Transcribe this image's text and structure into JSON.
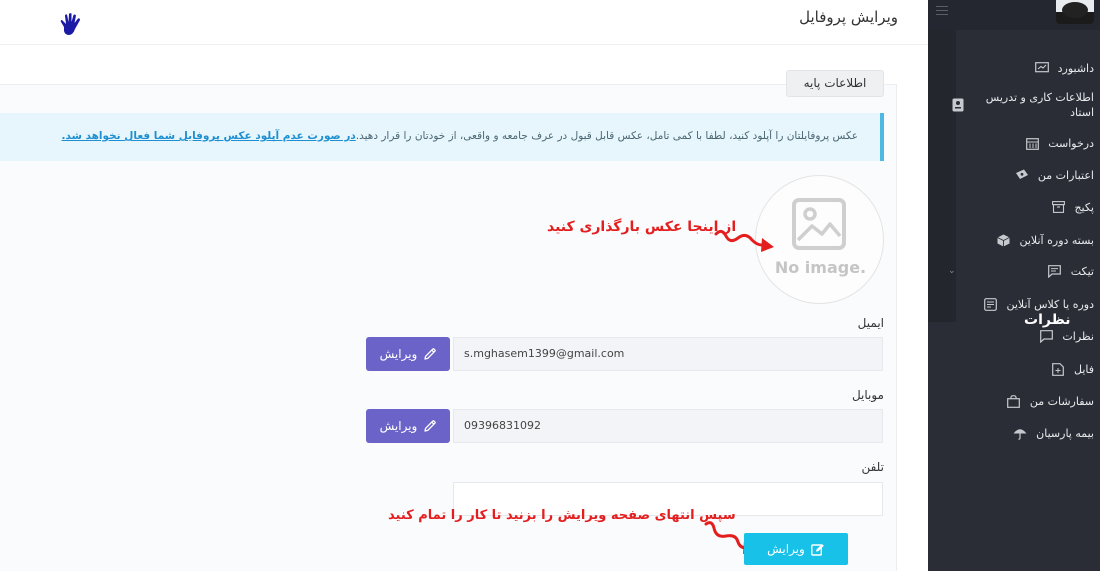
{
  "header": {
    "title": "ویرایش پروفایل"
  },
  "tab": {
    "label": "اطلاعات پایه"
  },
  "alert": {
    "text": "عکس پروفایلتان را آپلود کنید، لطفا با کمی تامل، عکس قابل قبول در عرف جامعه و واقعی، از خودتان را قرار دهید.",
    "warning": "در صورت عدم آپلود عکس پروفایل شما فعال نخواهد شد."
  },
  "avatar": {
    "placeholder": "No image."
  },
  "annotations": {
    "upload_hint": "از اینجا عکس بارگذاری کنید",
    "finish_hint": "سپس انتهای صفحه ویرایش را بزنید تا کار را تمام کنید"
  },
  "form": {
    "email_label": "ایمیل",
    "email_value": "s.mghasem1399@gmail.com",
    "mobile_label": "موبایل",
    "mobile_value": "09396831092",
    "phone_label": "تلفن",
    "phone_value": "",
    "edit_label": "ویرایش",
    "submit_label": "ویرایش"
  },
  "sidebar": {
    "items": [
      {
        "label": "داشبورد",
        "icon": "chart-icon"
      },
      {
        "label": "اطلاعات کاری و تدریس استاد",
        "icon": "id-card-icon"
      },
      {
        "label": "درخواست",
        "icon": "calendar-icon"
      },
      {
        "label": "اعتبارات من",
        "icon": "money-icon"
      },
      {
        "label": "پکیج",
        "icon": "archive-icon"
      },
      {
        "label": "بسته دوره آنلاین",
        "icon": "box-icon"
      },
      {
        "label": "تیکت",
        "icon": "message-icon"
      },
      {
        "label": "دوره یا کلاس آنلاین",
        "icon": "list-icon"
      },
      {
        "label": "نظرات",
        "icon": "comment-icon"
      },
      {
        "label": "فایل",
        "icon": "file-icon"
      },
      {
        "label": "سفارشات من",
        "icon": "bag-icon"
      },
      {
        "label": "بیمه پارسیان",
        "icon": "umbrella-icon"
      }
    ],
    "hover_label": "نظرات"
  },
  "colors": {
    "sidebar_bg": "#2a2d35",
    "edit_button": "#6c63c8",
    "submit_button": "#17c1e8",
    "alert_bg": "#e6f6fc",
    "annotation": "#e41e1e"
  }
}
